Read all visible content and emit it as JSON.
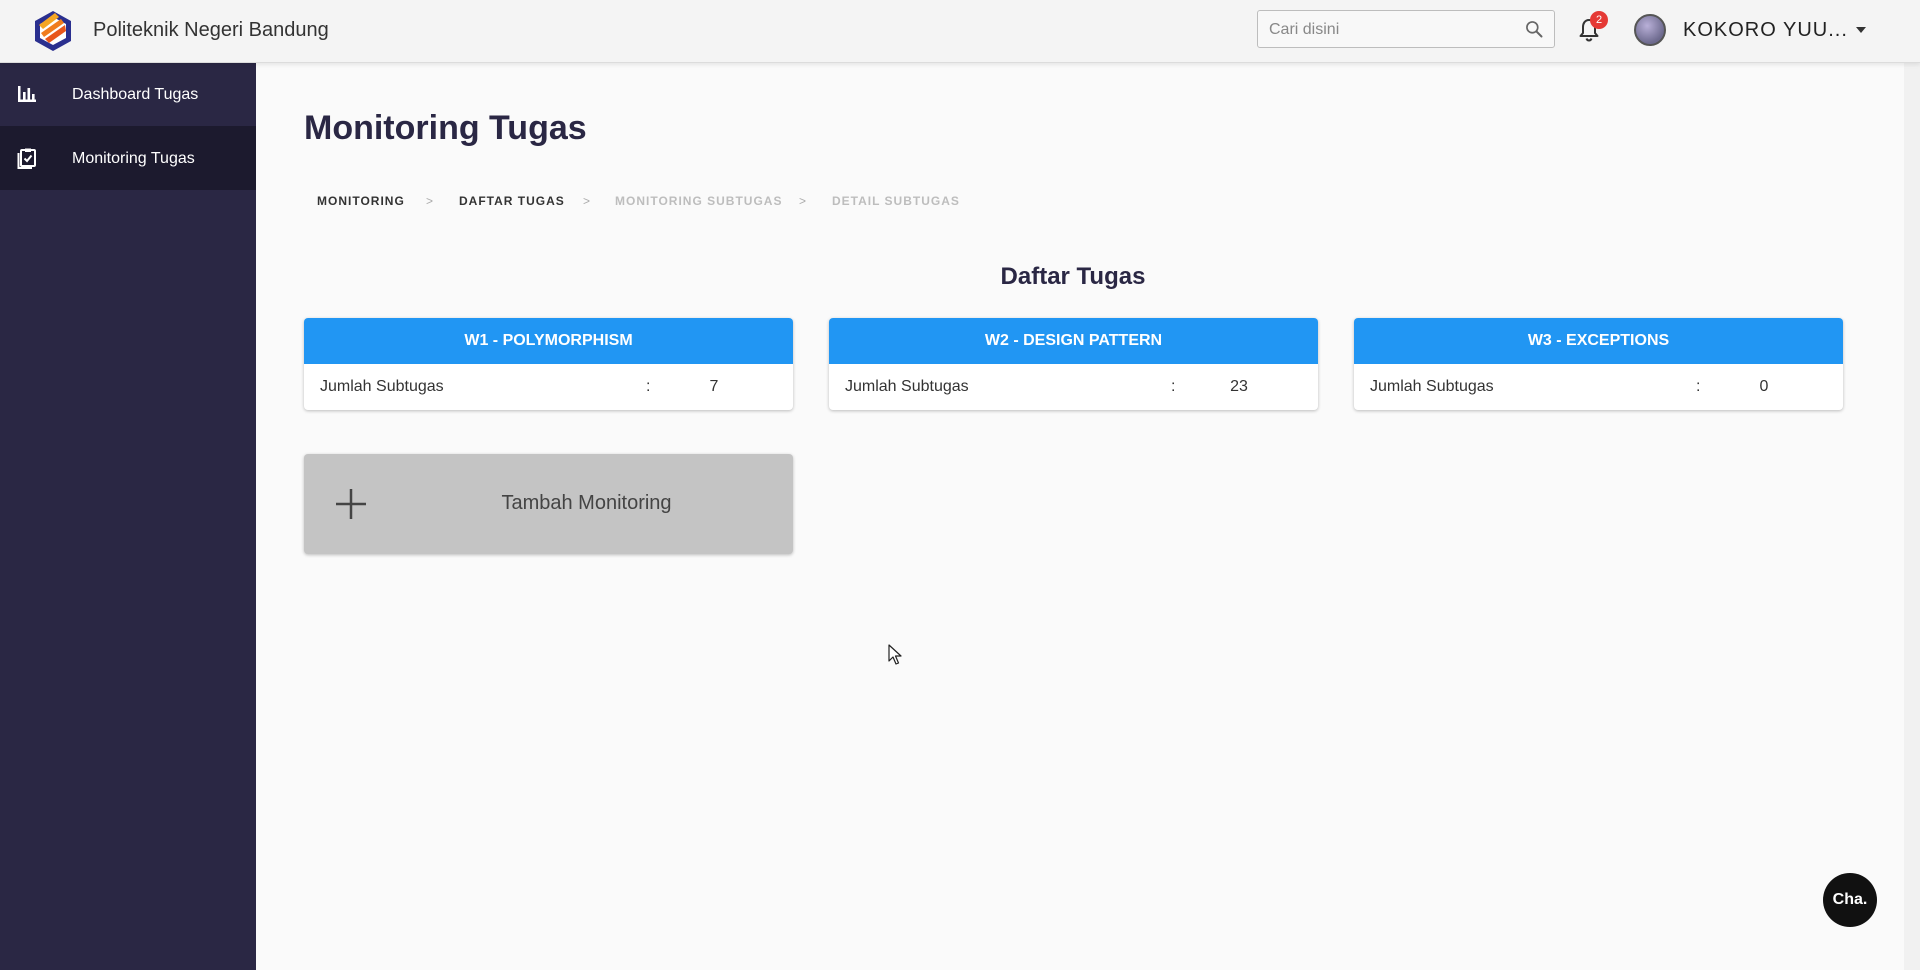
{
  "header": {
    "brand": "Politeknik Negeri Bandung",
    "search_placeholder": "Cari disini",
    "notification_count": "2",
    "username": "KOKORO YUU..."
  },
  "sidebar": {
    "items": [
      {
        "label": "Dashboard Tugas",
        "icon": "bar-chart-icon",
        "active": false
      },
      {
        "label": "Monitoring Tugas",
        "icon": "clipboard-check-icon",
        "active": true
      }
    ]
  },
  "main": {
    "title": "Monitoring Tugas",
    "breadcrumb": [
      {
        "label": "MONITORING",
        "state": "active"
      },
      {
        "label": "DAFTAR TUGAS",
        "state": "active"
      },
      {
        "label": "MONITORING SUBTUGAS",
        "state": "disabled"
      },
      {
        "label": "DETAIL SUBTUGAS",
        "state": "disabled"
      }
    ],
    "breadcrumb_separator": ">",
    "section_title": "Daftar Tugas",
    "tasks": [
      {
        "title": "W1 - POLYMORPHISM",
        "count_label": "Jumlah Subtugas",
        "colon": ":",
        "count": "7"
      },
      {
        "title": "W2 - DESIGN PATTERN",
        "count_label": "Jumlah Subtugas",
        "colon": ":",
        "count": "23"
      },
      {
        "title": "W3 - EXCEPTIONS",
        "count_label": "Jumlah Subtugas",
        "colon": ":",
        "count": "0"
      }
    ],
    "add_label": "Tambah Monitoring"
  },
  "chat_button": "Cha.",
  "colors": {
    "sidebar_bg": "#2a2744",
    "sidebar_active": "#1c1a2e",
    "card_header": "#2196f3",
    "add_card": "#c4c4c4",
    "badge": "#e53935"
  }
}
